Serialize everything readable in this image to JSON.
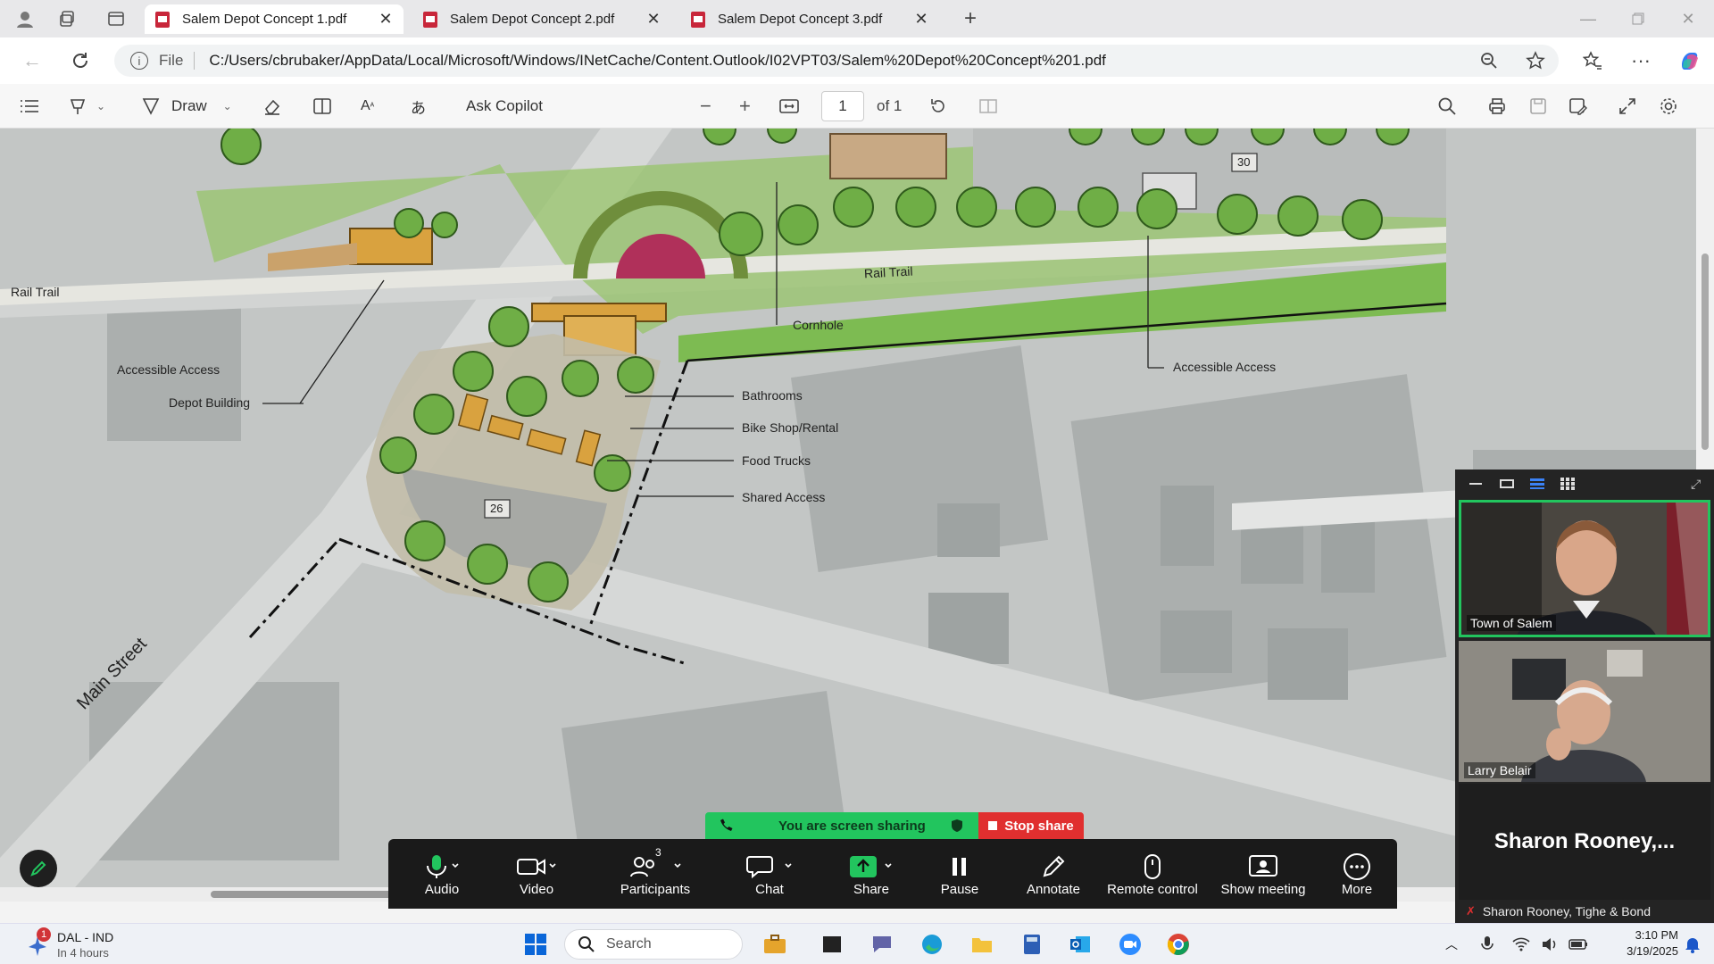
{
  "browser": {
    "tabs": [
      {
        "title": "Salem Depot Concept 1.pdf",
        "active": true
      },
      {
        "title": "Salem Depot Concept 2.pdf",
        "active": false
      },
      {
        "title": "Salem Depot Concept 3.pdf",
        "active": false
      }
    ],
    "file_label": "File",
    "url": "C:/Users/cbrubaker/AppData/Local/Microsoft/Windows/INetCache/Content.Outlook/I02VPT03/Salem%20Depot%20Concept%201.pdf"
  },
  "pdf_toolbar": {
    "draw_label": "Draw",
    "ask_copilot": "Ask Copilot",
    "page_current": "1",
    "page_total": "of 1"
  },
  "map": {
    "labels": {
      "rail_trail_left": "Rail Trail",
      "rail_trail_center": "Rail Trail",
      "cornhole": "Cornhole",
      "accessible_access_left": "Accessible Access",
      "accessible_access_right": "Accessible Access",
      "depot_building": "Depot Building",
      "bathrooms": "Bathrooms",
      "bike_shop": "Bike Shop/Rental",
      "food_trucks": "Food Trucks",
      "shared_access": "Shared Access",
      "main_street": "Main Street",
      "parking_26": "26",
      "parking_30": "30"
    }
  },
  "zoom": {
    "sharing_banner": "You are screen sharing",
    "stop_share": "Stop share",
    "participants_count": "3",
    "controls": [
      "Audio",
      "Video",
      "Participants",
      "Chat",
      "Share",
      "Pause",
      "Annotate",
      "Remote control",
      "Show meeting",
      "More"
    ],
    "participants": [
      {
        "name": "Town of Salem"
      },
      {
        "name": "Larry Belair"
      }
    ],
    "active_speaker": "Sharon  Rooney,...",
    "speaker_footer": "Sharon Rooney, Tighe & Bond"
  },
  "taskbar": {
    "weather_title": "DAL - IND",
    "weather_sub": "In 4 hours",
    "notification_count": "1",
    "search_placeholder": "Search",
    "time": "3:10 PM",
    "date": "3/19/2025"
  },
  "colors": {
    "zoom_green": "#22c55e",
    "stop_red": "#e02f2f",
    "plan_green": "#7dbb52",
    "building_orange": "#d9a23f",
    "accent_maroon": "#b0305a"
  }
}
